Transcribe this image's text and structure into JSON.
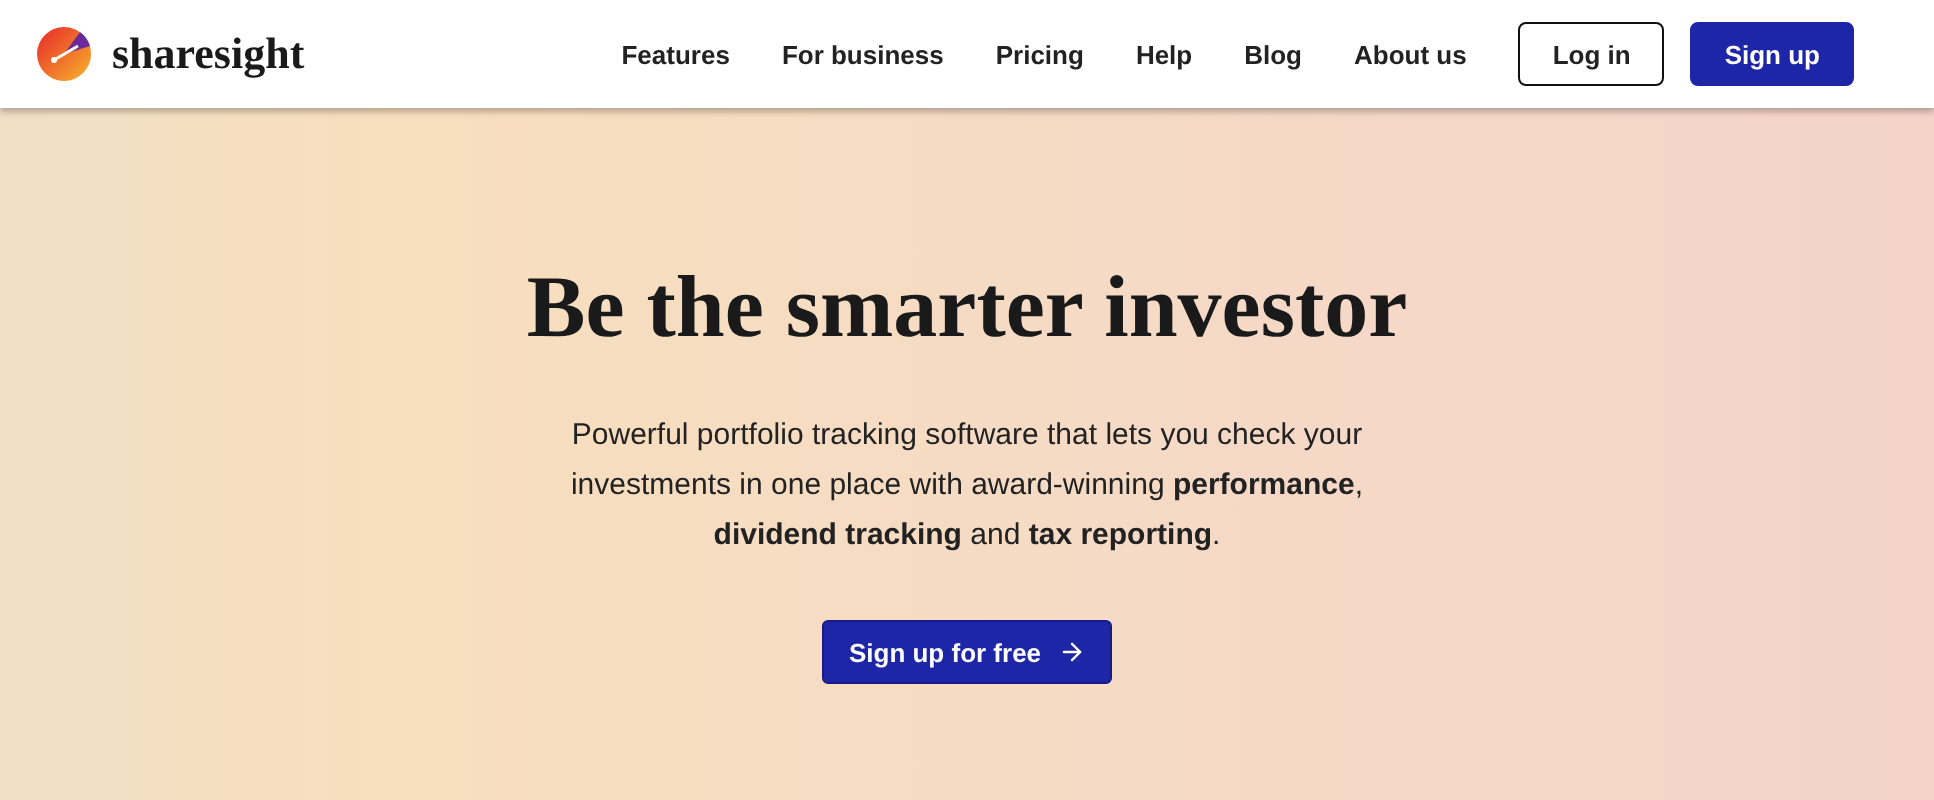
{
  "header": {
    "brand": "sharesight",
    "nav": [
      {
        "label": "Features"
      },
      {
        "label": "For business"
      },
      {
        "label": "Pricing"
      },
      {
        "label": "Help"
      },
      {
        "label": "Blog"
      },
      {
        "label": "About us"
      }
    ],
    "login": "Log in",
    "signup": "Sign up"
  },
  "hero": {
    "title": "Be the smarter investor",
    "description": "Powerful portfolio tracking software that lets you check your investments in one place with award-winning **performance**, **dividend tracking** and **tax reporting**.",
    "cta": "Sign up for free"
  }
}
